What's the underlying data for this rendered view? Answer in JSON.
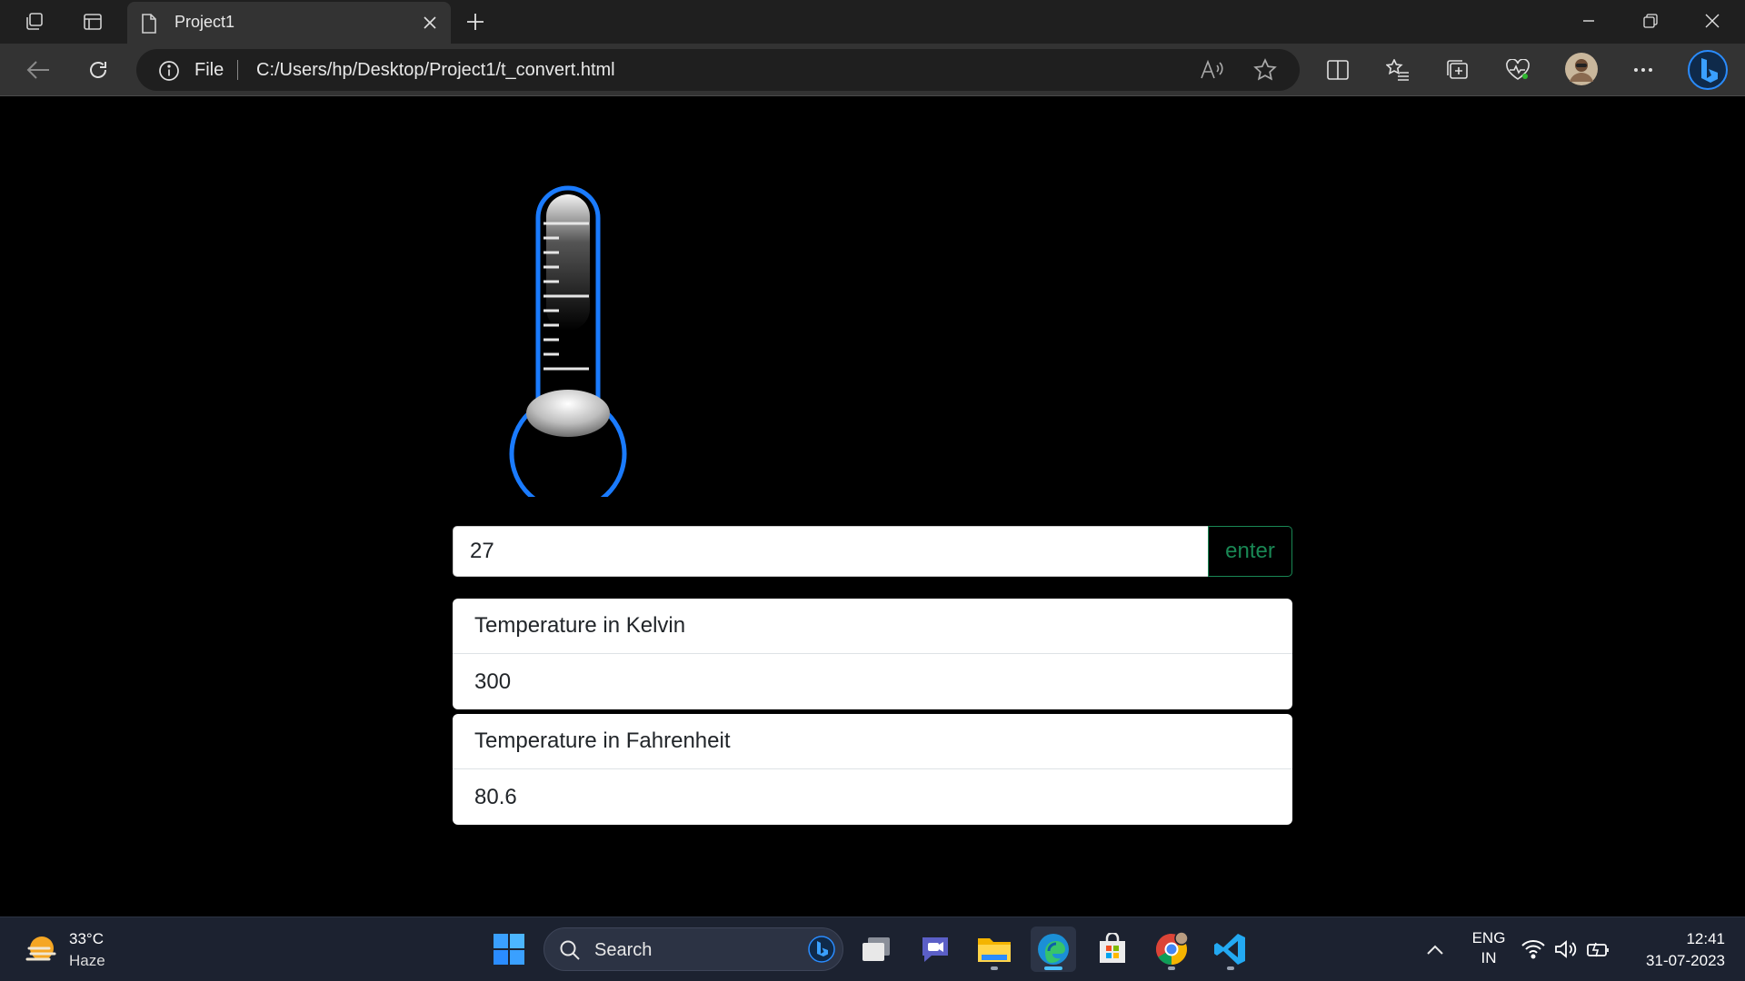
{
  "browser": {
    "tab_title": "Project1",
    "omnibox": {
      "scheme_label": "File",
      "url": "C:/Users/hp/Desktop/Project1/t_convert.html"
    }
  },
  "converter": {
    "input_value": "27",
    "button_label": "enter",
    "results": [
      {
        "label": "Temperature in Kelvin",
        "value": "300"
      },
      {
        "label": "Temperature in Fahrenheit",
        "value": "80.6"
      }
    ]
  },
  "taskbar": {
    "weather_temp": "33°C",
    "weather_cond": "Haze",
    "search_label": "Search",
    "language": "ENG",
    "region": "IN",
    "time": "12:41",
    "date": "31-07-2023"
  },
  "colors": {
    "accent_green": "#198754",
    "thermometer_blue": "#1a7bff"
  }
}
